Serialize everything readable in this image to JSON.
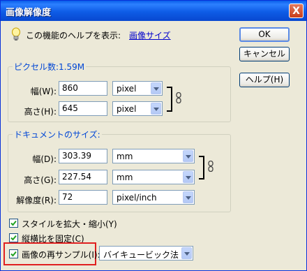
{
  "window": {
    "title": "画像解像度",
    "close_glyph": "X"
  },
  "help": {
    "text": "この機能のヘルプを表示:",
    "link": "画像サイズ"
  },
  "buttons": {
    "ok": "OK",
    "cancel": "キャンセル",
    "help": "ヘルプ(H)"
  },
  "pixel_dimensions": {
    "legend": "ピクセル数:1.59M",
    "width_label": "幅(W):",
    "width_value": "860",
    "width_unit": "pixel",
    "height_label": "高さ(H):",
    "height_value": "645",
    "height_unit": "pixel"
  },
  "document_size": {
    "legend": "ドキュメントのサイズ:",
    "width_label": "幅(D):",
    "width_value": "303.39",
    "width_unit": "mm",
    "height_label": "高さ(G):",
    "height_value": "227.54",
    "height_unit": "mm",
    "resolution_label": "解像度(R):",
    "resolution_value": "72",
    "resolution_unit": "pixel/inch"
  },
  "options": {
    "scale_styles": {
      "label": "スタイルを拡大・縮小(Y)",
      "checked": true
    },
    "constrain": {
      "label": "縦横比を固定(C)",
      "checked": true
    },
    "resample": {
      "label": "画像の再サンプル(I):",
      "checked": true,
      "method": "バイキュービック法"
    }
  },
  "colors": {
    "title_bar": "#0a5fea",
    "legend_text": "#0046d5",
    "link": "#0000cc",
    "highlight": "#e02020"
  }
}
